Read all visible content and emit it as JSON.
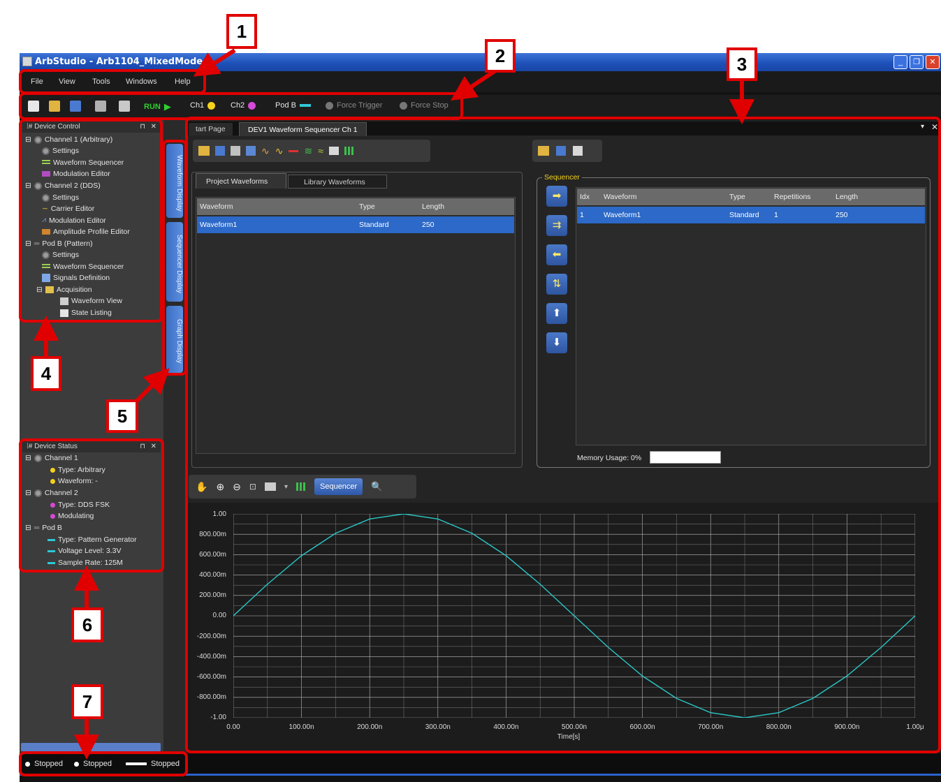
{
  "window": {
    "title": "ArbStudio - Arb1104_MixedMode",
    "controls": [
      "minimize-icon",
      "restore-icon",
      "close-icon"
    ]
  },
  "menu": [
    "File",
    "View",
    "Tools",
    "Windows",
    "Help"
  ],
  "toolbar": {
    "run_label": "RUN",
    "ch1_label": "Ch1",
    "ch2_label": "Ch2",
    "podb_label": "Pod B",
    "force_trigger": "Force Trigger",
    "force_stop": "Force Stop",
    "ch1_color": "#f4d21c",
    "ch2_color": "#d64ad6",
    "podb_color": "#2ec8d8"
  },
  "device_control": {
    "title": "Device Control",
    "items": [
      "Channel 1 (Arbitrary)",
      "Settings",
      "Waveform Sequencer",
      "Modulation Editor",
      "Channel 2 (DDS)",
      "Settings",
      "Carrier Editor",
      "Modulation Editor",
      "Amplitude Profile Editor",
      "Pod B (Pattern)",
      "Settings",
      "Waveform Sequencer",
      "Signals Definition",
      "Acquisition",
      "Waveform View",
      "State Listing"
    ]
  },
  "side_tabs": [
    "Waveform Display",
    "Sequencer Display",
    "Graph Display"
  ],
  "device_status": {
    "title": "Device Status",
    "items": [
      "Channel 1",
      "Type: Arbitrary",
      "Waveform: -",
      "Channel 2",
      "Type: DDS FSK",
      "Modulating",
      "Pod B",
      "Type: Pattern Generator",
      "Voltage Level: 3.3V",
      "Sample Rate: 125M"
    ]
  },
  "status_bar": [
    "Stopped",
    "Stopped",
    "Stopped"
  ],
  "doc_tabs": [
    "tart Page",
    "DEV1 Waveform Sequencer Ch 1"
  ],
  "waveforms_panel": {
    "tabs": [
      "Project Waveforms",
      "Library Waveforms"
    ],
    "columns": [
      "Waveform",
      "Type",
      "Length"
    ],
    "rows": [
      [
        "Waveform1",
        "Standard",
        "250"
      ]
    ]
  },
  "sequencer": {
    "title": "Sequencer",
    "columns": [
      "Idx",
      "Waveform",
      "Type",
      "Repetitions",
      "Length"
    ],
    "rows": [
      [
        "1",
        "Waveform1",
        "Standard",
        "1",
        "250"
      ]
    ],
    "memory_label": "Memory Usage: 0%",
    "memory_fraction": 0
  },
  "graph_toolbar": {
    "sequencer_button": "Sequencer"
  },
  "chart_data": {
    "type": "line",
    "series": [
      {
        "x": [
          0,
          0.05,
          0.1,
          0.15,
          0.2,
          0.25,
          0.3,
          0.35,
          0.4,
          0.45,
          0.5,
          0.55,
          0.6,
          0.65,
          0.7,
          0.75,
          0.8,
          0.85,
          0.9,
          0.95,
          1.0
        ],
        "y": [
          0,
          0.31,
          0.59,
          0.81,
          0.95,
          1.0,
          0.95,
          0.81,
          0.59,
          0.31,
          0,
          -0.31,
          -0.59,
          -0.81,
          -0.95,
          -1.0,
          -0.95,
          -0.81,
          -0.59,
          -0.31,
          0
        ],
        "color": "#2bc6c6"
      }
    ],
    "yticks": [
      "1.00",
      "800.00m",
      "600.00m",
      "400.00m",
      "200.00m",
      "0.00",
      "-200.00m",
      "-400.00m",
      "-600.00m",
      "-800.00m",
      "-1.00"
    ],
    "xticks": [
      "0.00",
      "100.00n",
      "200.00n",
      "300.00n",
      "400.00n",
      "500.00n",
      "600.00n",
      "700.00n",
      "800.00n",
      "900.00n",
      "1.00μ"
    ],
    "xlabel": "Time[s]",
    "xlim": [
      0,
      1.0
    ],
    "ylim": [
      -1.0,
      1.0
    ],
    "grid": true
  },
  "callouts": [
    "1",
    "2",
    "3",
    "4",
    "5",
    "6",
    "7"
  ]
}
